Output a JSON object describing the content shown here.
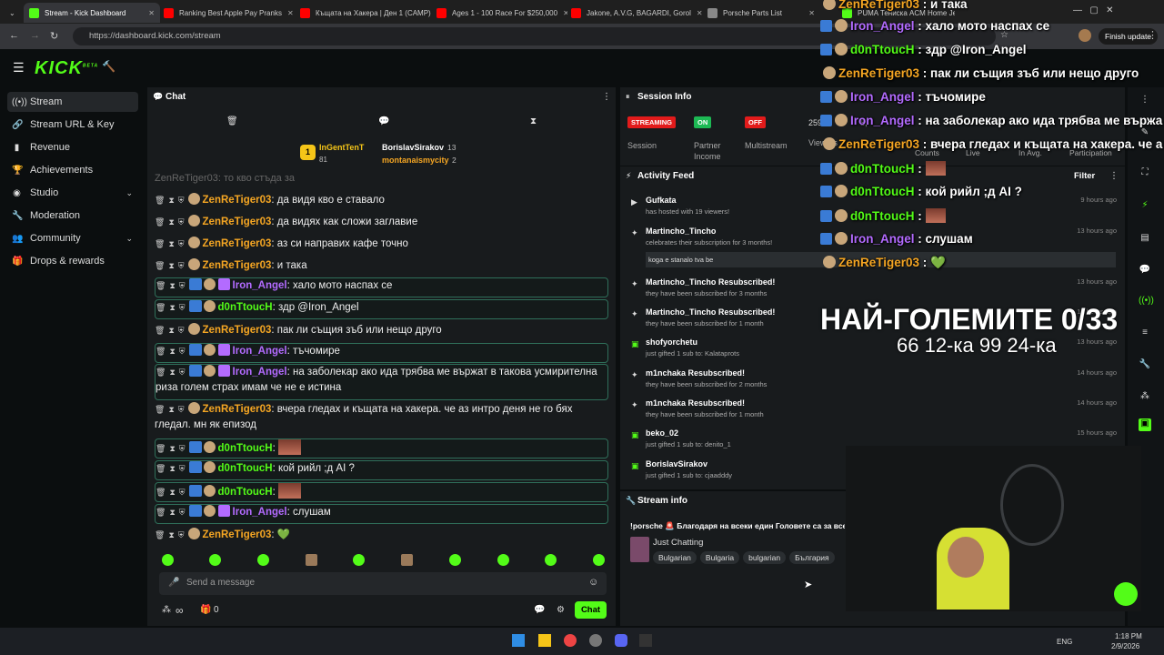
{
  "browser": {
    "tabs": [
      {
        "label": "Stream - Kick Dashboard",
        "active": true,
        "color": "#53fc18"
      },
      {
        "label": "Ranking Best Apple Pay Pranks",
        "color": "#ff0000"
      },
      {
        "label": "Къщата на Хакера | Ден 1 (CAMP)",
        "color": "#ff0000"
      },
      {
        "label": "Ages 1 - 100 Race For $250,000",
        "color": "#ff0000"
      },
      {
        "label": "Jakone, A.V.G, BAGARDI, Gorol",
        "color": "#ff0000"
      },
      {
        "label": "Porsche Parts List",
        "color": "#888888"
      },
      {
        "label": "PUMA Тениска ACM Home Jersey",
        "color": "#53fc18"
      }
    ],
    "url": "https://dashboard.kick.com/stream",
    "update_button": "Finish update"
  },
  "brand": {
    "logo": "KICK",
    "beta": "BETA"
  },
  "sidebar": {
    "items": [
      {
        "label": "Stream",
        "icon": "broadcast-icon"
      },
      {
        "label": "Stream URL & Key",
        "icon": "link-icon"
      },
      {
        "label": "Revenue",
        "icon": "chart-icon"
      },
      {
        "label": "Achievements",
        "icon": "trophy-icon"
      },
      {
        "label": "Studio",
        "icon": "studio-icon"
      },
      {
        "label": "Moderation",
        "icon": "wrench-icon"
      },
      {
        "label": "Community",
        "icon": "community-icon"
      },
      {
        "label": "Drops & rewards",
        "icon": "gift-icon"
      }
    ]
  },
  "chat": {
    "title": "Chat",
    "leaders": [
      {
        "name": "InGentTenT",
        "count": "81"
      },
      {
        "name": "BorislavSirakov",
        "count": "13"
      },
      {
        "name": "montanaismycity",
        "count": "2"
      }
    ],
    "partial_top": "ZenReTiger03: то кво стъда за",
    "messages": [
      {
        "user": "ZenReTiger03",
        "color": "#f5a623",
        "text": "да видя кво е ставало",
        "badges": false,
        "hl": false
      },
      {
        "user": "ZenReTiger03",
        "color": "#f5a623",
        "text": "да видях как сложи заглавие",
        "badges": false,
        "hl": false
      },
      {
        "user": "ZenReTiger03",
        "color": "#f5a623",
        "text": "аз си направих кафе точно",
        "badges": false,
        "hl": false
      },
      {
        "user": "ZenReTiger03",
        "color": "#f5a623",
        "text": "и така",
        "badges": false,
        "hl": false
      },
      {
        "user": "Iron_Angel",
        "color": "#b36bff",
        "text": "хало мото наспах се",
        "badges": true,
        "gift": true,
        "hl": true
      },
      {
        "user": "d0nTtoucH",
        "color": "#53fc18",
        "text": "здр @Iron_Angel",
        "badges": true,
        "gift": false,
        "hl": true
      },
      {
        "user": "ZenReTiger03",
        "color": "#f5a623",
        "text": "пак ли същия зъб или нещо друго",
        "badges": false,
        "hl": false
      },
      {
        "user": "Iron_Angel",
        "color": "#b36bff",
        "text": "тъчомире",
        "badges": true,
        "gift": true,
        "hl": true
      },
      {
        "user": "Iron_Angel",
        "color": "#b36bff",
        "text": "на заболекар ако ида трябва ме вържат в такова усмирителна риза голем страх имам че не е истина",
        "badges": true,
        "gift": true,
        "hl": true
      },
      {
        "user": "ZenReTiger03",
        "color": "#f5a623",
        "text": "вчера гледах и къщата на хакера. че аз интро деня не го бях гледал. мн як епизод",
        "badges": false,
        "hl": false
      },
      {
        "user": "d0nTtoucH",
        "color": "#53fc18",
        "text": "",
        "badges": true,
        "gift": false,
        "hl": true,
        "emote": true
      },
      {
        "user": "d0nTtoucH",
        "color": "#53fc18",
        "text": "кой рийл ;д AI ?",
        "badges": true,
        "gift": false,
        "hl": true
      },
      {
        "user": "d0nTtoucH",
        "color": "#53fc18",
        "text": "",
        "badges": true,
        "gift": false,
        "hl": true,
        "emote": true
      },
      {
        "user": "Iron_Angel",
        "color": "#b36bff",
        "text": "слушам",
        "badges": true,
        "gift": true,
        "hl": true
      },
      {
        "user": "ZenReTiger03",
        "color": "#f5a623",
        "text": "💚",
        "badges": false,
        "hl": false
      }
    ],
    "placeholder": "Send a message",
    "points": "∞",
    "gifts_count": "0",
    "send_label": "Chat"
  },
  "session": {
    "title": "Session Info",
    "items": [
      {
        "pill": "STREAMING",
        "pill_color": "#e21b1b",
        "label": "Session"
      },
      {
        "pill": "ON",
        "pill_color": "#1db954",
        "label": "Partner Income"
      },
      {
        "pill": "OFF",
        "pill_color": "#e21b1b",
        "label": "Multistream"
      }
    ],
    "viewers_partial": "259",
    "viewers_label": "Viewers",
    "followers_partial": "8,",
    "extra_labels": [
      "Counts",
      "Live",
      "In Avg.",
      "Participation"
    ]
  },
  "activity": {
    "title": "Activity Feed",
    "filter": "Filter",
    "items": [
      {
        "name": "Gufkata",
        "sub": "has hosted with 19 viewers!",
        "time": "9 hours ago",
        "icon": "host-icon"
      },
      {
        "name": "Martincho_Tincho",
        "sub": "celebrates their subscription for 3 months!",
        "time": "13 hours ago",
        "icon": "celebrate-icon",
        "note": "koga e stanalo tva be"
      },
      {
        "name": "Martincho_Tincho Resubscribed!",
        "sub": "they have been subscribed for 3 months",
        "time": "13 hours ago",
        "icon": "star-icon"
      },
      {
        "name": "Martincho_Tincho Resubscribed!",
        "sub": "they have been subscribed for 1 month",
        "time": "13 hours ago",
        "icon": "star-icon"
      },
      {
        "name": "shofyorchetu",
        "sub": "just gifted 1 sub to: Kalataprots",
        "time": "13 hours ago",
        "icon": "gift-icon"
      },
      {
        "name": "m1nchaka Resubscribed!",
        "sub": "they have been subscribed for 2 months",
        "time": "14 hours ago",
        "icon": "star-icon"
      },
      {
        "name": "m1nchaka Resubscribed!",
        "sub": "they have been subscribed for 1 month",
        "time": "14 hours ago",
        "icon": "star-icon"
      },
      {
        "name": "beko_02",
        "sub": "just gifted 1 sub to: denito_1",
        "time": "15 hours ago",
        "icon": "gift-icon"
      },
      {
        "name": "BorislavSirakov",
        "sub": "just gifted 1 sub to: cjaadddy",
        "time": "",
        "icon": "gift-icon"
      }
    ]
  },
  "stream_info": {
    "title": "Stream info",
    "stream_title": "!porsche 🚨 Благодаря на всеки един Головете са за все",
    "category": "Just Chatting",
    "tags": [
      "Bulgarian",
      "Bulgaria",
      "bulgarian",
      "България"
    ]
  },
  "overlay": {
    "chat": [
      {
        "user": "ZenReTiger03",
        "text": "и така",
        "color": "#f5a623",
        "b": false
      },
      {
        "user": "Iron_Angel",
        "text": "хало мото наспах се",
        "color": "#b36bff",
        "b": true
      },
      {
        "user": "d0nTtoucH",
        "text": "здр @Iron_Angel",
        "color": "#53fc18",
        "b": true
      },
      {
        "user": "ZenReTiger03",
        "text": "пак ли същия зъб или нещо друго",
        "color": "#f5a623",
        "b": false
      },
      {
        "user": "Iron_Angel",
        "text": "тъчомире",
        "color": "#b36bff",
        "b": true
      },
      {
        "user": "Iron_Angel",
        "text": "на заболекар ако ида трябва ме вържа",
        "color": "#b36bff",
        "b": true
      },
      {
        "user": "ZenReTiger03",
        "text": "вчера гледах и къщата на хакера. че а",
        "color": "#f5a623",
        "b": false
      },
      {
        "user": "d0nTtoucH",
        "text": "",
        "color": "#53fc18",
        "b": true
      },
      {
        "user": "d0nTtoucH",
        "text": "кой рийл ;д AI ?",
        "color": "#53fc18",
        "b": true
      },
      {
        "user": "d0nTtoucH",
        "text": "",
        "color": "#53fc18",
        "b": true
      },
      {
        "user": "Iron_Angel",
        "text": "слушам",
        "color": "#b36bff",
        "b": true
      },
      {
        "user": "ZenReTiger03",
        "text": "💚",
        "color": "#f5a623",
        "b": false
      }
    ],
    "big_title": "НАЙ-ГОЛЕМИТЕ 0/33",
    "big_sub": "66 12-ка 99 24-ка"
  },
  "taskbar": {
    "lang": "ENG",
    "time": "1:18 PM",
    "date": "2/9/2026"
  }
}
